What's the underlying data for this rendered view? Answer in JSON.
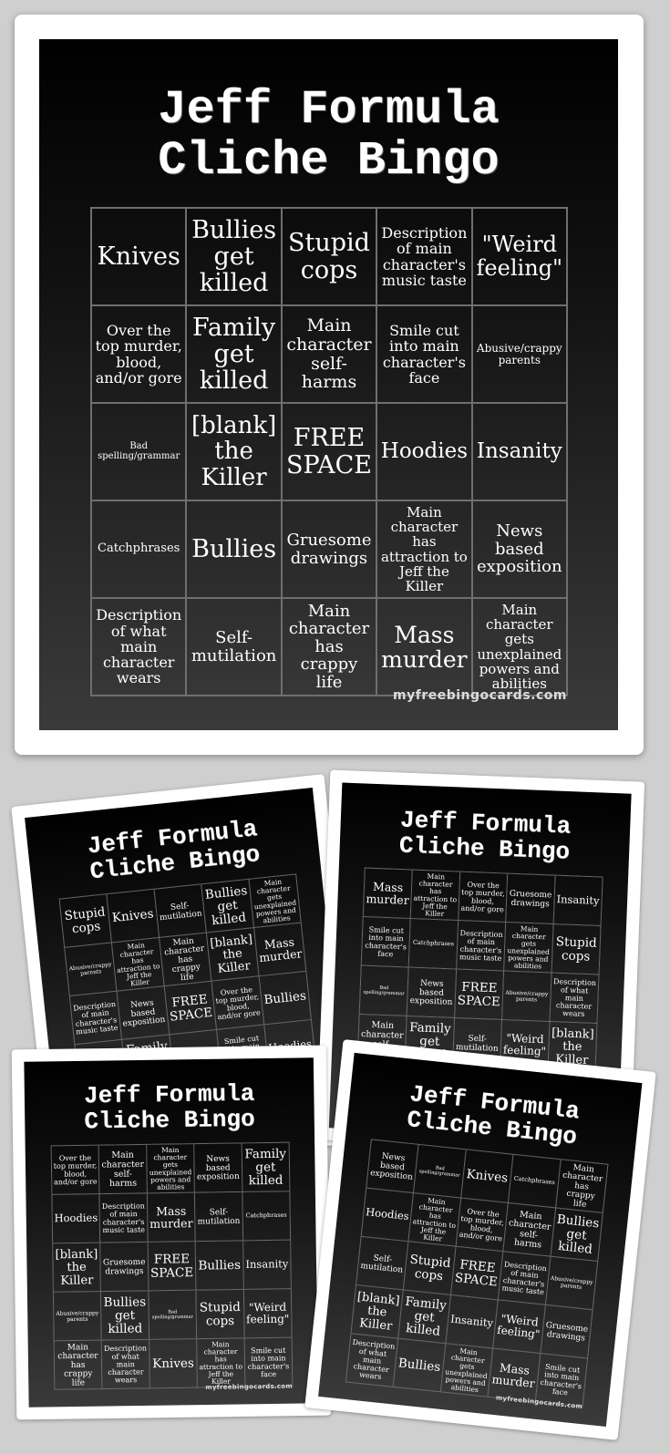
{
  "watermark": "myfreebingocards.com",
  "cards": [
    {
      "title_line1": "Jeff Formula",
      "title_line2": "Cliche Bingo",
      "cells": [
        "Knives",
        "Bullies get killed",
        "Stupid cops",
        "Description of main character's music taste",
        "\"Weird feeling\"",
        "Over the top murder, blood, and/or gore",
        "Family get killed",
        "Main character self-harms",
        "Smile cut into main character's face",
        "Abusive/crappy parents",
        "Bad spelling/grammar",
        "[blank] the Killer",
        "FREE SPACE",
        "Hoodies",
        "Insanity",
        "Catchphrases",
        "Bullies",
        "Gruesome drawings",
        "Main character has attraction to Jeff the Killer",
        "News based exposition",
        "Description of what main character wears",
        "Self-mutilation",
        "Main character has crappy life",
        "Mass murder",
        "Main character gets unexplained powers and abilities"
      ]
    },
    {
      "title_line1": "Jeff Formula",
      "title_line2": "Cliche Bingo",
      "cells": [
        "Stupid cops",
        "Knives",
        "Self-mutilation",
        "Bullies get killed",
        "Main character gets unexplained powers and abilities",
        "Abusive/crappy parents",
        "Main character has attraction to Jeff the Killer",
        "Main character has crappy life",
        "[blank] the Killer",
        "Mass murder",
        "Description of main character's music taste",
        "News based exposition",
        "FREE SPACE",
        "Over the top murder, blood, and/or gore",
        "Bullies",
        "",
        "Family get killed",
        "",
        "Smile cut into main character's face",
        "Hoodies",
        "",
        "",
        "",
        "",
        ""
      ]
    },
    {
      "title_line1": "Jeff Formula",
      "title_line2": "Cliche Bingo",
      "cells": [
        "Mass murder",
        "Main character has attraction to Jeff the Killer",
        "Over the top murder, blood, and/or gore",
        "Gruesome drawings",
        "Insanity",
        "Smile cut into main character's face",
        "Catchphrases",
        "Description of main character's music taste",
        "Main character gets unexplained powers and abilities",
        "Stupid cops",
        "Bad spelling/grammar",
        "News based exposition",
        "FREE SPACE",
        "Abusive/crappy parents",
        "Description of what main character wears",
        "Main character self-harms",
        "Family get killed",
        "Self-mutilation",
        "\"Weird feeling\"",
        "[blank] the Killer",
        "",
        "",
        "",
        "",
        ""
      ]
    },
    {
      "title_line1": "Jeff Formula",
      "title_line2": "Cliche Bingo",
      "cells": [
        "Over the top murder, blood, and/or gore",
        "Main character self-harms",
        "Main character gets unexplained powers and abilities",
        "News based exposition",
        "Family get killed",
        "Hoodies",
        "Description of main character's music taste",
        "Mass murder",
        "Self-mutilation",
        "Catchphrases",
        "[blank] the Killer",
        "Gruesome drawings",
        "FREE SPACE",
        "Bullies",
        "Insanity",
        "Abusive/crappy parents",
        "Bullies get killed",
        "Bad spelling/grammar",
        "Stupid cops",
        "\"Weird feeling\"",
        "Main character has crappy life",
        "Description of what main character wears",
        "Knives",
        "Main character has attraction to Jeff the Killer",
        "Smile cut into main character's face"
      ]
    },
    {
      "title_line1": "Jeff Formula",
      "title_line2": "Cliche Bingo",
      "cells": [
        "News based exposition",
        "Bad spelling/grammar",
        "Knives",
        "Catchphrases",
        "Main character has crappy life",
        "Hoodies",
        "Main character has attraction to Jeff the Killer",
        "Over the top murder, blood, and/or gore",
        "Main character self-harms",
        "Bullies get killed",
        "Self-mutilation",
        "Stupid cops",
        "FREE SPACE",
        "Description of main character's music taste",
        "Abusive/crappy parents",
        "[blank] the Killer",
        "Family get killed",
        "Insanity",
        "\"Weird feeling\"",
        "Gruesome drawings",
        "Description of what main character wears",
        "Bullies",
        "Main character gets unexplained powers and abilities",
        "Mass murder",
        "Smile cut into main character's face"
      ]
    }
  ]
}
